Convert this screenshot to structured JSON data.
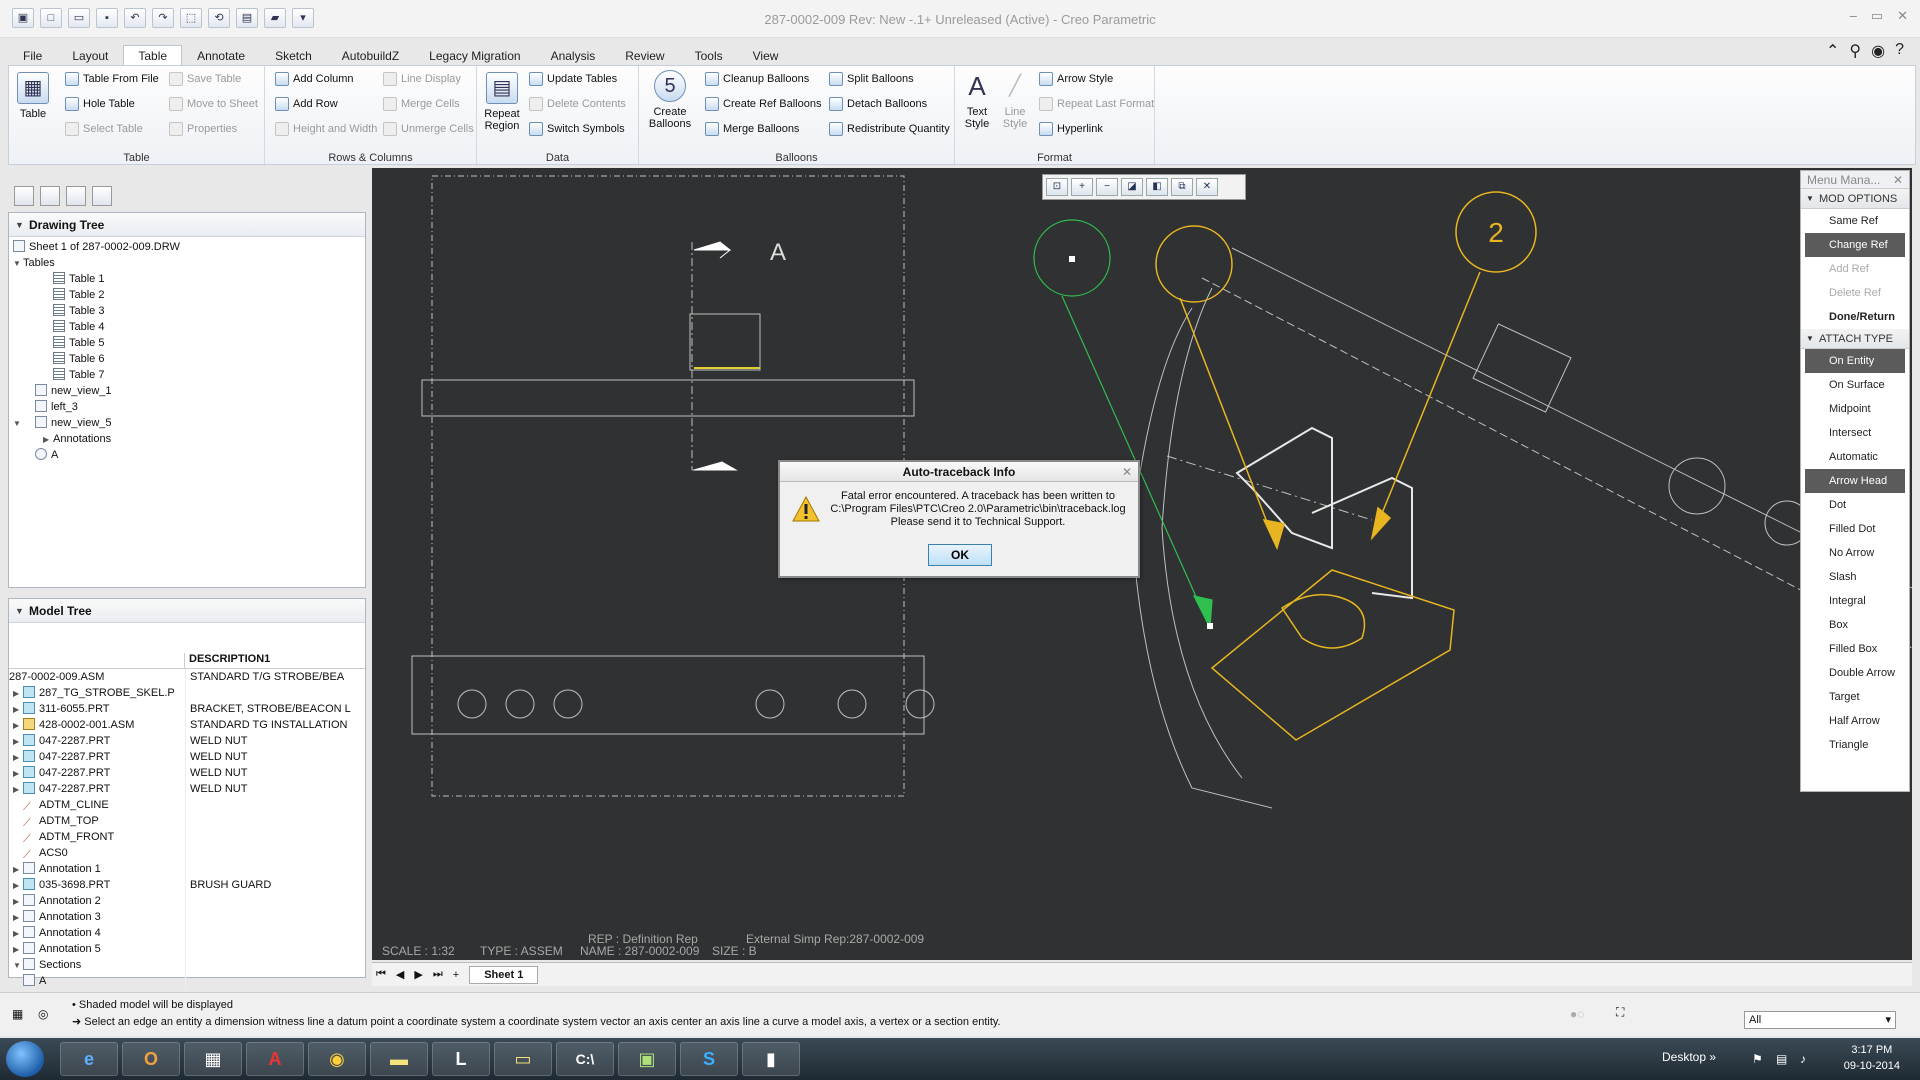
{
  "window": {
    "title": "287-0002-009 Rev: New -.1+ Unreleased  (Active) - Creo Parametric"
  },
  "tabs": [
    "File",
    "Layout",
    "Table",
    "Annotate",
    "Sketch",
    "AutobuildZ",
    "Legacy Migration",
    "Analysis",
    "Review",
    "Tools",
    "View"
  ],
  "ribbon": {
    "table_group": {
      "label": "Table",
      "table_btn": "Table",
      "table_from_file": "Table From File",
      "hole_table": "Hole Table",
      "select_table": "Select Table",
      "save_table": "Save Table",
      "move_to_sheet": "Move to Sheet",
      "properties": "Properties"
    },
    "rows_group": {
      "label": "Rows & Columns",
      "add_column": "Add Column",
      "add_row": "Add Row",
      "height_width": "Height and Width",
      "line_display": "Line Display",
      "merge_cells": "Merge Cells",
      "unmerge_cells": "Unmerge Cells"
    },
    "data_group": {
      "label": "Data",
      "repeat_region": "Repeat Region",
      "update_tables": "Update Tables",
      "delete_contents": "Delete Contents",
      "switch_symbols": "Switch Symbols"
    },
    "balloons_group": {
      "label": "Balloons",
      "create_balloons": "Create Balloons",
      "cleanup_balloons": "Cleanup Balloons",
      "create_ref_balloons": "Create Ref Balloons",
      "merge_balloons": "Merge Balloons",
      "split_balloons": "Split Balloons",
      "detach_balloons": "Detach Balloons",
      "redistribute_quantity": "Redistribute Quantity"
    },
    "format_group": {
      "label": "Format",
      "text_style": "Text Style",
      "line_style": "Line Style",
      "arrow_style": "Arrow Style",
      "repeat_last_format": "Repeat Last Format",
      "hyperlink": "Hyperlink"
    }
  },
  "drawing_tree": {
    "title": "Drawing Tree",
    "rows": [
      "Sheet 1 of 287-0002-009.DRW",
      "Tables",
      "Table 1",
      "Table 2",
      "Table 3",
      "Table 4",
      "Table 5",
      "Table 6",
      "Table 7",
      "new_view_1",
      "left_3",
      "new_view_5",
      "Annotations",
      "A"
    ]
  },
  "model_tree": {
    "title": "Model Tree",
    "column": "DESCRIPTION1",
    "rows": [
      {
        "name": "287-0002-009.ASM",
        "desc": "STANDARD T/G STROBE/BEA"
      },
      {
        "name": "287_TG_STROBE_SKEL.P",
        "desc": ""
      },
      {
        "name": "311-6055.PRT",
        "desc": "BRACKET, STROBE/BEACON L"
      },
      {
        "name": "428-0002-001.ASM",
        "desc": "STANDARD TG INSTALLATION"
      },
      {
        "name": "047-2287.PRT",
        "desc": "WELD NUT"
      },
      {
        "name": "047-2287.PRT",
        "desc": "WELD NUT"
      },
      {
        "name": "047-2287.PRT",
        "desc": "WELD NUT"
      },
      {
        "name": "047-2287.PRT",
        "desc": "WELD NUT"
      },
      {
        "name": "ADTM_CLINE",
        "desc": ""
      },
      {
        "name": "ADTM_TOP",
        "desc": ""
      },
      {
        "name": "ADTM_FRONT",
        "desc": ""
      },
      {
        "name": "ACS0",
        "desc": ""
      },
      {
        "name": "Annotation 1",
        "desc": ""
      },
      {
        "name": "035-3698.PRT",
        "desc": "BRUSH GUARD"
      },
      {
        "name": "Annotation 2",
        "desc": ""
      },
      {
        "name": "Annotation 3",
        "desc": ""
      },
      {
        "name": "Annotation 4",
        "desc": ""
      },
      {
        "name": "Annotation 5",
        "desc": ""
      },
      {
        "name": "Sections",
        "desc": ""
      },
      {
        "name": "A",
        "desc": ""
      }
    ]
  },
  "canvas": {
    "section_label": "A",
    "balloon_number": "2",
    "scale": "SCALE : 1:32",
    "type": "TYPE : ASSEM",
    "name": "NAME : 287-0002-009",
    "size": "SIZE : B",
    "rep": "REP : Definition Rep",
    "simp_rep": "External Simp Rep:287-0002-009"
  },
  "menu_manager": {
    "title": "Menu Mana...",
    "sections": [
      {
        "name": "MOD OPTIONS",
        "items": [
          {
            "label": "Same Ref",
            "state": "normal"
          },
          {
            "label": "Change Ref",
            "state": "selected"
          },
          {
            "label": "Add Ref",
            "state": "disabled"
          },
          {
            "label": "Delete Ref",
            "state": "disabled"
          },
          {
            "label": "Done/Return",
            "state": "bold"
          }
        ]
      },
      {
        "name": "ATTACH TYPE",
        "items": [
          {
            "label": "On Entity",
            "state": "selected"
          },
          {
            "label": "On Surface",
            "state": "normal"
          },
          {
            "label": "Midpoint",
            "state": "normal"
          },
          {
            "label": "Intersect",
            "state": "normal"
          },
          {
            "label": "Automatic",
            "state": "normal"
          },
          {
            "label": "Arrow Head",
            "state": "selected"
          },
          {
            "label": "Dot",
            "state": "normal"
          },
          {
            "label": "Filled Dot",
            "state": "normal"
          },
          {
            "label": "No Arrow",
            "state": "normal"
          },
          {
            "label": "Slash",
            "state": "normal"
          },
          {
            "label": "Integral",
            "state": "normal"
          },
          {
            "label": "Box",
            "state": "normal"
          },
          {
            "label": "Filled Box",
            "state": "normal"
          },
          {
            "label": "Double Arrow",
            "state": "normal"
          },
          {
            "label": "Target",
            "state": "normal"
          },
          {
            "label": "Half Arrow",
            "state": "normal"
          },
          {
            "label": "Triangle",
            "state": "normal"
          }
        ]
      }
    ]
  },
  "dialog": {
    "title": "Auto-traceback Info",
    "line1": "Fatal error encountered. A traceback has been written to",
    "line2": "C:\\Program Files\\PTC\\Creo 2.0\\Parametric\\bin\\traceback.log",
    "line3": "Please send it to Technical Support.",
    "ok": "OK"
  },
  "sheetbar": {
    "sheet": "Sheet 1"
  },
  "status": {
    "msg1": "Shaded model will be displayed",
    "msg2": "Select an edge an entity a dimension witness line a datum point a coordinate system a coordinate system vector an axis center an axis line a curve a model axis, a vertex or a section entity.",
    "filter": "All"
  },
  "taskbar": {
    "desktop": "Desktop",
    "time": "3:17 PM",
    "date": "09-10-2014"
  },
  "colors": {
    "canvas_bg": "#2f3132",
    "balloon_yellow": "#e8b520",
    "leader_green": "#2fbf4f"
  }
}
